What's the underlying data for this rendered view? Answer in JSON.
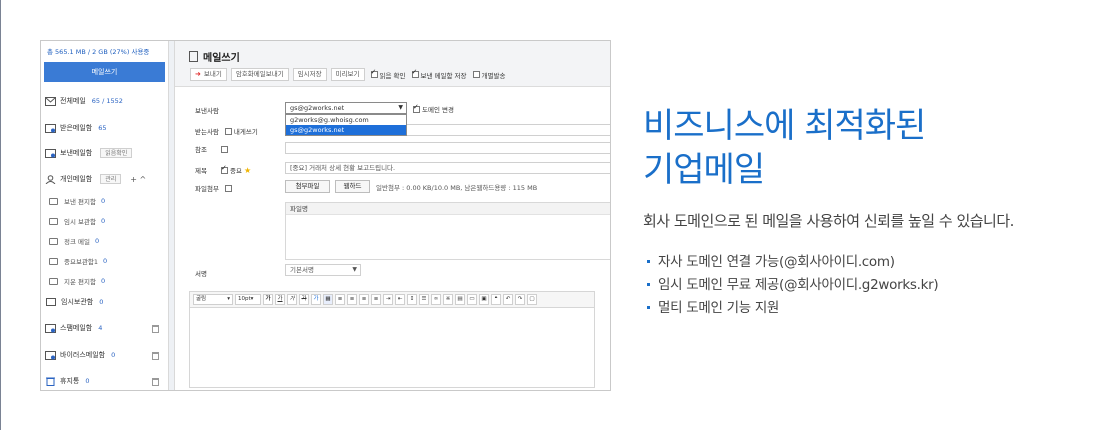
{
  "headline": {
    "line1": "비즈니스에 최적화된",
    "line2": "기업메일"
  },
  "description": "회사 도메인으로 된 메일을 사용하여 신뢰를 높일 수 있습니다.",
  "bullets": [
    "자사 도메인 연결 가능(@회사아이디.com)",
    "임시 도메인 무료 제공(@회사아이디.g2works.kr)",
    "멀티 도메인 기능 지원"
  ],
  "sidebar": {
    "quota": "총 565.1 MB / 2 GB (27%) 사용중",
    "compose": "메일쓰기",
    "items": [
      {
        "label": "전체메일",
        "count": "65 / 1552"
      },
      {
        "label": "받은메일함",
        "count": "65"
      },
      {
        "label": "보낸메일함",
        "button": "읽음확인"
      },
      {
        "label": "개인메일함",
        "button": "관리",
        "actions": "+ ^"
      }
    ],
    "folders": [
      {
        "label": "보낸 편지함",
        "count": "0"
      },
      {
        "label": "임시 보관함",
        "count": "0"
      },
      {
        "label": "정크 메일",
        "count": "0"
      },
      {
        "label": "중요보관함1",
        "count": "0"
      },
      {
        "label": "지운 편지함",
        "count": "0"
      }
    ],
    "bottom_items": [
      {
        "label": "임시보관함",
        "count": "0"
      },
      {
        "label": "스팸메일함",
        "count": "4"
      },
      {
        "label": "바이러스메일함",
        "count": "0"
      },
      {
        "label": "휴지통",
        "count": "0"
      }
    ]
  },
  "compose": {
    "title": "메일쓰기",
    "toolbar": {
      "send": "보내기",
      "encrypted": "암호화메일보내기",
      "save_draft": "임시저장",
      "preview": "미리보기",
      "read_receipt": "읽음 확인",
      "save_sent": "보낸 메일함 저장",
      "individual": "개별발송"
    },
    "labels": {
      "from": "보낸사람",
      "to": "받는사람",
      "to_self": "내게쓰기",
      "cc": "참조",
      "subject": "제목",
      "important": "중요",
      "attachment": "파일첨부",
      "signature": "서명"
    },
    "from_value": "gs@g2works.net",
    "domain_change": "도메인 변경",
    "from_options": [
      "g2works@g.whoisg.com",
      "gs@g2works.net"
    ],
    "subject_value": "[중요] 거래처 상세 현황 보고드립니다.",
    "attach_buttons": {
      "file": "첨부파일",
      "webhard": "웹하드"
    },
    "attach_info": "일반첨부 : 0.00 KB/10.0 MB,  남은웹하드용량 : 115 MB",
    "file_name_header": "파일명",
    "signature_value": "기본서명",
    "editor": {
      "font": "굴림",
      "size": "10pt"
    }
  },
  "colors": {
    "accent": "#1a6fc9",
    "compose_button": "#3a7bd5"
  }
}
